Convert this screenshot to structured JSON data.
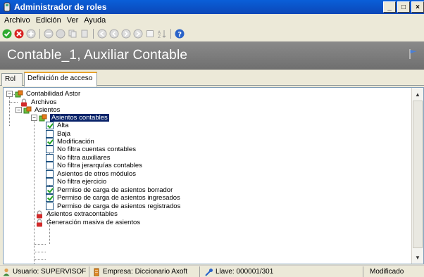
{
  "window": {
    "title": "Administrador de roles",
    "controls": {
      "minimize": "_",
      "maximize": "□",
      "close": "×"
    }
  },
  "menu": [
    {
      "label": "Archivo"
    },
    {
      "label": "Edición"
    },
    {
      "label": "Ver"
    },
    {
      "label": "Ayuda"
    }
  ],
  "toolbar": {
    "buttons": [
      "confirm-icon",
      "cancel-icon",
      "add-icon",
      "remove-icon",
      "move-icon",
      "copy-icon",
      "paste-icon",
      "nav-first-icon",
      "nav-prev-icon",
      "nav-next-icon",
      "nav-last-icon",
      "blank-icon",
      "sort-icon",
      "help-icon"
    ]
  },
  "header": {
    "title": "Contable_1, Auxiliar Contable"
  },
  "tabs": [
    {
      "label": "Rol"
    },
    {
      "label": "Definición de acceso",
      "active": true
    }
  ],
  "tree": {
    "nodes": [
      {
        "label": "Contabilidad Astor",
        "type": "folder",
        "expanded": true
      },
      {
        "label": "Archivos",
        "type": "lock"
      },
      {
        "label": "Asientos",
        "type": "folder",
        "expanded": true
      },
      {
        "label": "Asientos contables",
        "type": "folder",
        "expanded": true,
        "selected": true
      },
      {
        "label": "Alta",
        "checked": true
      },
      {
        "label": "Baja",
        "checked": false
      },
      {
        "label": "Modificación",
        "checked": true
      },
      {
        "label": "No filtra cuentas contables",
        "checked": false
      },
      {
        "label": "No filtra auxiliares",
        "checked": false
      },
      {
        "label": "No filtra jerarquías contables",
        "checked": false
      },
      {
        "label": "Asientos de otros módulos",
        "checked": false
      },
      {
        "label": "No filtra ejercicio",
        "checked": false
      },
      {
        "label": "Permiso de carga de asientos borrador",
        "checked": true
      },
      {
        "label": "Permiso de carga de asientos ingresados",
        "checked": true
      },
      {
        "label": "Permiso de carga de asientos registrados",
        "checked": false
      },
      {
        "label": "Asientos extracontables",
        "type": "lock"
      },
      {
        "label": "Generación masiva de asientos",
        "type": "lock"
      }
    ]
  },
  "status": {
    "user": "Usuario: SUPERVISOF",
    "company": "Empresa: Diccionario Axoft",
    "key": "Llave: 000001/301",
    "state": "Modificado"
  },
  "colors": {
    "titlebar": "#0a5fd8",
    "header_band": "#7d7d7d",
    "selection": "#0a246a",
    "tab_accent": "#e8a32a"
  }
}
